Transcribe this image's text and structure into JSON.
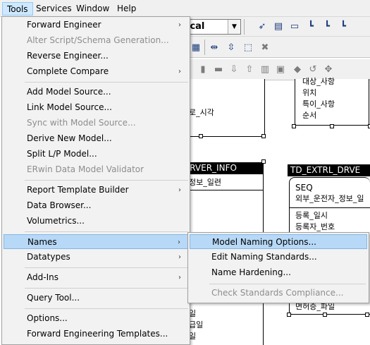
{
  "menubar": {
    "items": [
      {
        "label": "Tools"
      },
      {
        "label": "Services"
      },
      {
        "label": "Window"
      },
      {
        "label": "Help"
      }
    ]
  },
  "toolbar": {
    "combo_value": "ical"
  },
  "tools_menu": {
    "items": [
      {
        "label": "Forward Engineer",
        "arrow": "›"
      },
      {
        "label": "Alter Script/Schema Generation..."
      },
      {
        "label": "Reverse Engineer..."
      },
      {
        "label": "Complete Compare",
        "arrow": "›"
      },
      {
        "label": "Add Model Source..."
      },
      {
        "label": "Link Model Source..."
      },
      {
        "label": "Sync with Model Source..."
      },
      {
        "label": "Derive New Model..."
      },
      {
        "label": "Split L/P Model..."
      },
      {
        "label": "ERwin Data Model Validator"
      },
      {
        "label": "Report Template Builder",
        "arrow": "›"
      },
      {
        "label": "Data Browser..."
      },
      {
        "label": "Volumetrics..."
      },
      {
        "label": "Names",
        "arrow": "›"
      },
      {
        "label": "Datatypes",
        "arrow": "›"
      },
      {
        "label": "Add-Ins",
        "arrow": "›"
      },
      {
        "label": "Query Tool..."
      },
      {
        "label": "Options..."
      },
      {
        "label": "Forward Engineering Templates..."
      }
    ]
  },
  "names_menu": {
    "items": [
      {
        "label": "Model Naming Options..."
      },
      {
        "label": "Edit Naming Standards..."
      },
      {
        "label": "Name Hardening..."
      },
      {
        "label": "Check Standards Compliance..."
      }
    ]
  },
  "diagram": {
    "entity_top_right": {
      "lines": [
        "대상_사항",
        "위치",
        "특이_사항",
        "순서"
      ]
    },
    "left_fragment_1": "로_시각",
    "entity_drver": {
      "title": "DRVER_INFO",
      "line1": "정보_일련",
      "bottom_lines": [
        "일",
        "급일",
        "일"
      ]
    },
    "entity_extrl": {
      "title": "TD_EXTRL_DRVE",
      "key": "SEQ",
      "key_desc": "외부_운전자_정보_일",
      "lines": [
        "등록_일시",
        "등록자_번호"
      ],
      "bottom": "면허증_파일"
    }
  }
}
